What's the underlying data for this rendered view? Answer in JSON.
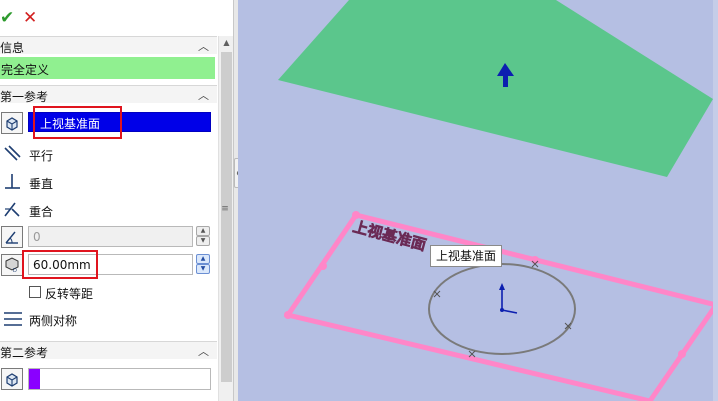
{
  "toolbar": {
    "ok_icon": "check-icon",
    "cancel_icon": "close-icon",
    "ok_glyph": "✔",
    "cancel_glyph": "✕"
  },
  "sections": {
    "info": {
      "title": "信息",
      "status": "完全定义"
    },
    "first_ref": {
      "title": "第一参考",
      "selection": "上视基准面",
      "options": [
        "平行",
        "垂直",
        "重合"
      ],
      "angle_value": "0",
      "distance_value": "60.00mm",
      "flip_offset_label": "反转等距",
      "symmetric_label": "两侧对称"
    },
    "second_ref": {
      "title": "第二参考"
    }
  },
  "viewport": {
    "tooltip": "上视基准面",
    "sketch_label": "上视基准面"
  },
  "colors": {
    "status_bg": "#90f090",
    "selection_bg": "#0000e8",
    "plane_green": "#5bc68c",
    "plane_pink": "#ff86c8",
    "viewport_bg": "#b5bfe3",
    "highlight": "#e0141e"
  }
}
